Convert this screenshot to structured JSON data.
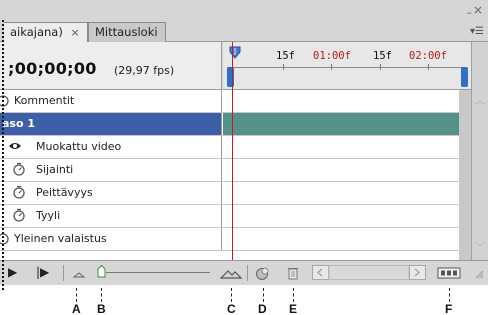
{
  "tabs": [
    {
      "label": "aikajana)",
      "close": "×",
      "active": true
    },
    {
      "label": "Mittausloki",
      "active": false
    }
  ],
  "window": {
    "minimize": "–",
    "close": "×",
    "menu": "▾☰"
  },
  "header": {
    "timecode": ";00;00;00",
    "fps": "(29,97 fps)"
  },
  "ruler": {
    "labels": [
      {
        "text": "15f",
        "color": "black"
      },
      {
        "text": "01:00f",
        "color": "red"
      },
      {
        "text": "15f",
        "color": "black"
      },
      {
        "text": "02:00f",
        "color": "red"
      }
    ]
  },
  "tracks": [
    {
      "label": "Kommentit",
      "icon": "stopwatch-icon",
      "selected": false
    },
    {
      "label": "aso 1",
      "icon": "none",
      "selected": true
    },
    {
      "label": "Muokattu video",
      "icon": "eye-icon",
      "selected": false
    },
    {
      "label": "Sijainti",
      "icon": "stopwatch-icon",
      "selected": false
    },
    {
      "label": "Peittävyys",
      "icon": "stopwatch-icon",
      "selected": false
    },
    {
      "label": "Tyyli",
      "icon": "stopwatch-icon",
      "selected": false
    },
    {
      "label": "Yleinen valaistus",
      "icon": "stopwatch-icon",
      "selected": false
    }
  ],
  "toolbar": {
    "play": "▶",
    "next_frame": "|▶",
    "zoom_out": "zoom-out-mountain-icon",
    "zoom_in": "zoom-in-mountain-icon",
    "onion_skin": "onion-skin-icon",
    "delete": "trash-icon",
    "convert": "convert-to-frame-animation-icon"
  },
  "callouts": [
    "A",
    "B",
    "C",
    "D",
    "E",
    "F"
  ],
  "colors": {
    "selection": "#3c5fa8",
    "layer_bar": "#55908a",
    "time_indicator": "#c01c1c",
    "work_handle": "#2f6fc4"
  }
}
